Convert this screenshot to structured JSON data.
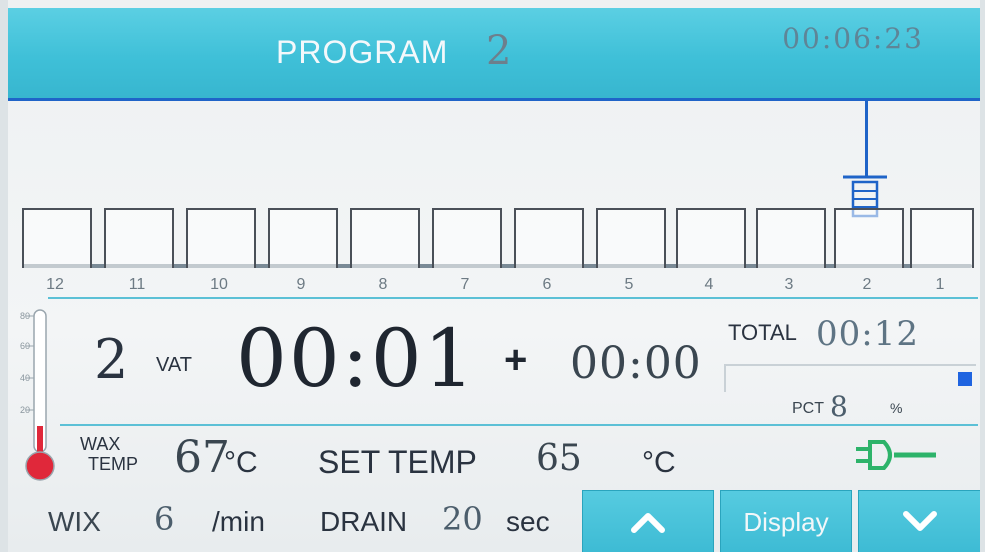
{
  "header": {
    "program_label": "PROGRAM",
    "program_number": "2",
    "clock": "00:06:23"
  },
  "vats": [
    {
      "number": "12"
    },
    {
      "number": "11"
    },
    {
      "number": "10"
    },
    {
      "number": "9"
    },
    {
      "number": "8"
    },
    {
      "number": "7"
    },
    {
      "number": "6"
    },
    {
      "number": "5"
    },
    {
      "number": "4"
    },
    {
      "number": "3"
    },
    {
      "number": "2"
    },
    {
      "number": "1"
    }
  ],
  "carrier_position_vat": "2",
  "thermometer": {
    "ticks": [
      "80",
      "60",
      "40",
      "20"
    ],
    "fill_color": "#e0283a"
  },
  "status": {
    "current_vat": "2",
    "vat_label": "VAT",
    "elapsed_time": "00:01",
    "plus": "+",
    "extra_time": "00:00",
    "total_label": "TOTAL",
    "total_time": "00:12",
    "pct_label": "PCT",
    "pct_value": "8",
    "pct_unit": "%",
    "progress_fraction": 0.08
  },
  "temperature": {
    "wax_label_line1": "WAX",
    "wax_label_line2": "TEMP",
    "wax_value": "67",
    "wax_unit": "°C",
    "set_label": "SET TEMP",
    "set_value": "65",
    "set_unit": "°C"
  },
  "mix": {
    "label": "WIX",
    "value": "6",
    "unit": "/min"
  },
  "drain": {
    "label": "DRAIN",
    "value": "20",
    "unit": "sec"
  },
  "buttons": {
    "up_icon": "chevron-up-icon",
    "display_label": "Display",
    "down_icon": "chevron-down-icon"
  },
  "colors": {
    "header_bg": "#3fc0d8",
    "accent_blue": "#1f64c8",
    "button_bg": "#3dbbd4",
    "pump_icon": "#2db36a"
  }
}
